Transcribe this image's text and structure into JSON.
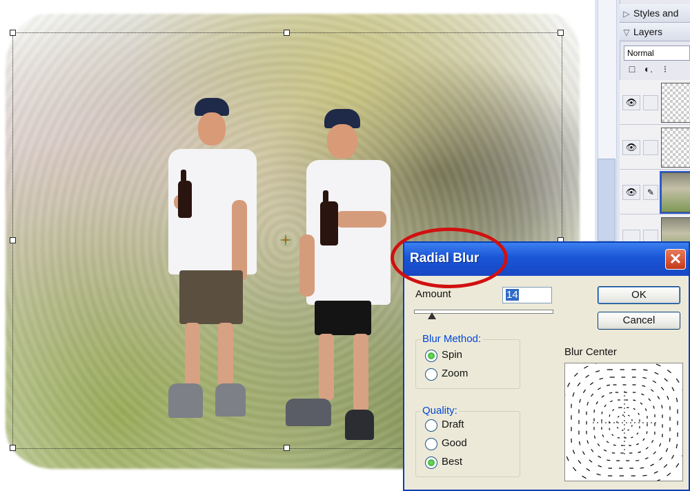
{
  "palette": {
    "panels": [
      {
        "label": "Styles and"
      },
      {
        "label": "Layers"
      }
    ],
    "blend_mode": "Normal",
    "tools": [
      "□",
      "◐.",
      "⁝"
    ],
    "layers": [
      {
        "visible": true,
        "thumb": "transparent-figure"
      },
      {
        "visible": true,
        "thumb": "transparent"
      },
      {
        "visible": true,
        "thumb": "photo",
        "selected": true
      },
      {
        "visible": false,
        "thumb": "photo"
      }
    ]
  },
  "dialog": {
    "title": "Radial Blur",
    "close_glyph": "✕",
    "amount_label": "Amount",
    "amount_value": "14",
    "amount_slider_fraction": 0.14,
    "ok_label": "OK",
    "cancel_label": "Cancel",
    "blur_method": {
      "label": "Blur Method:",
      "options": [
        {
          "label": "Spin",
          "selected": true
        },
        {
          "label": "Zoom",
          "selected": false
        }
      ]
    },
    "quality": {
      "label": "Quality:",
      "options": [
        {
          "label": "Draft",
          "selected": false
        },
        {
          "label": "Good",
          "selected": false
        },
        {
          "label": "Best",
          "selected": true
        }
      ]
    },
    "blur_center_label": "Blur Center"
  },
  "colors": {
    "dialog_title_bar": "#1a55d6",
    "highlight": "#d11010",
    "radio_selected": "#21a121"
  }
}
